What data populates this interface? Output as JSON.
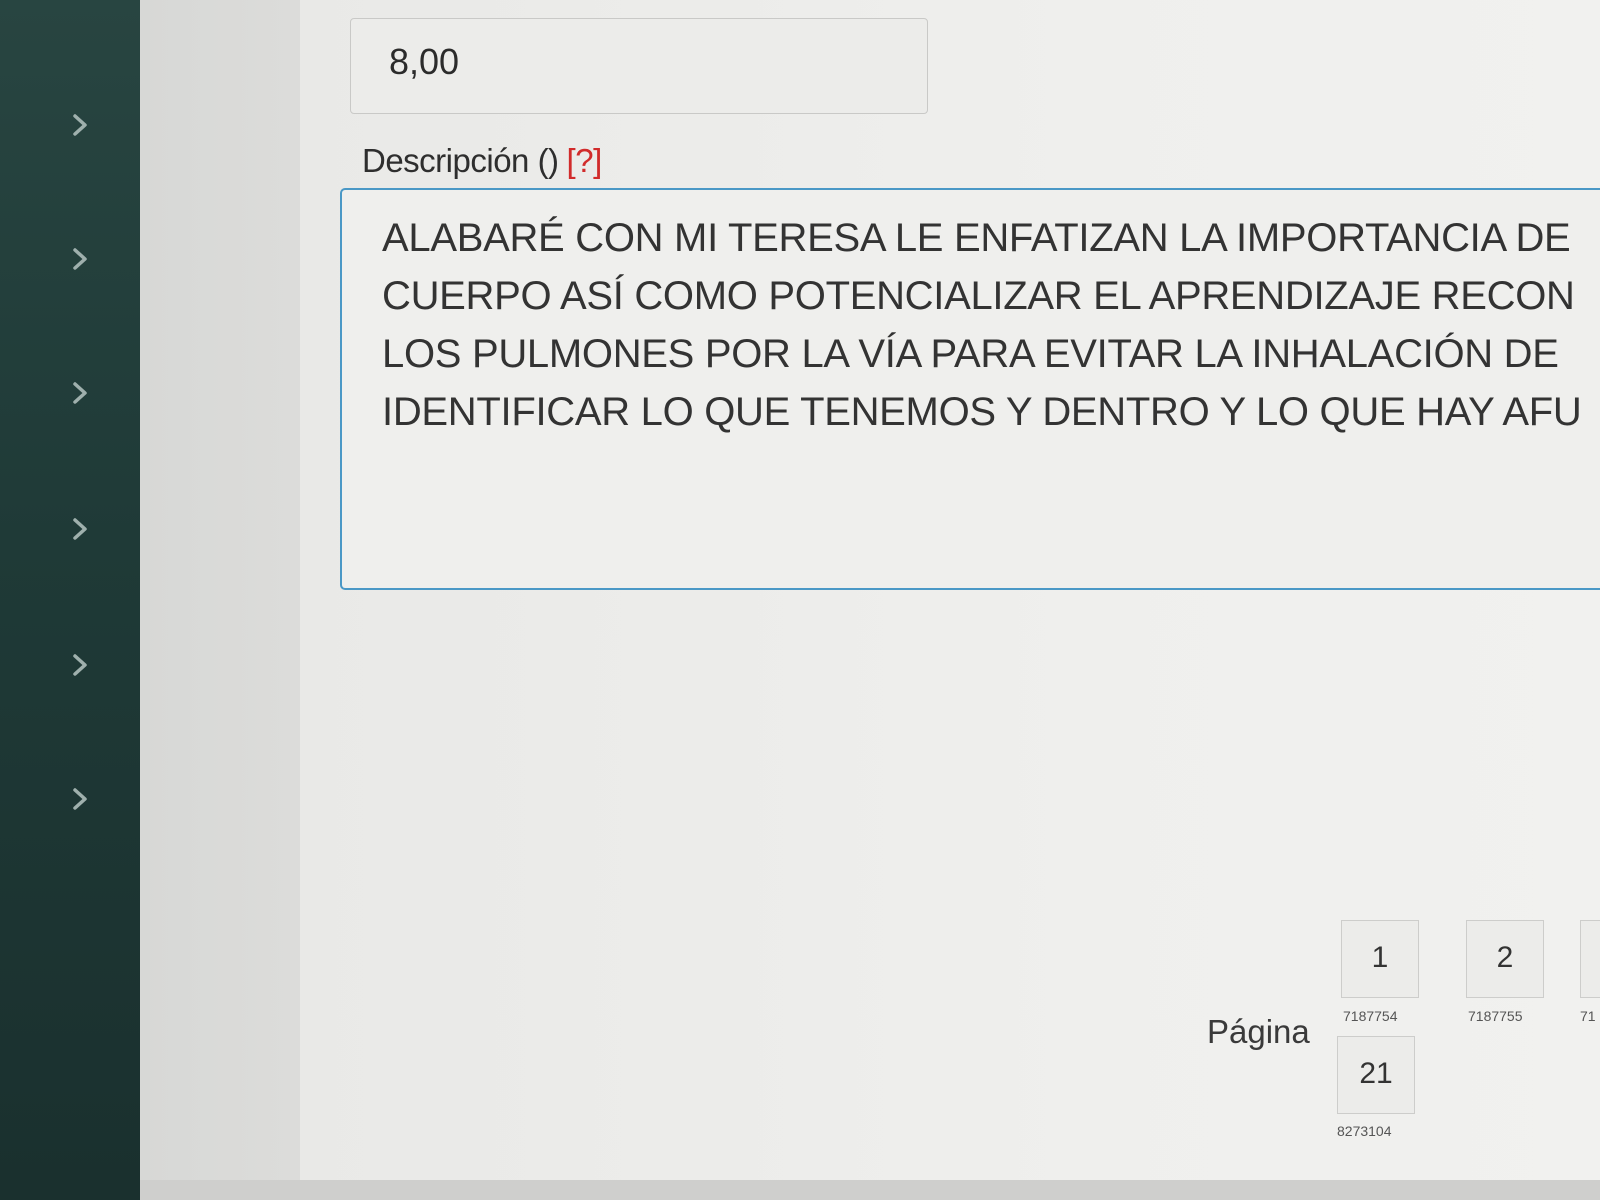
{
  "sidebar": {
    "items": [
      {
        "icon": "chevron-right-icon"
      },
      {
        "icon": "chevron-right-icon"
      },
      {
        "icon": "chevron-right-icon"
      },
      {
        "icon": "chevron-right-icon"
      },
      {
        "icon": "chevron-right-icon"
      },
      {
        "icon": "chevron-right-icon"
      }
    ]
  },
  "form": {
    "value_field": {
      "value": "8,00"
    },
    "description": {
      "label": "Descripción ()",
      "help": "[?]",
      "lines": [
        "ALABARÉ CON MI TERESA LE ENFATIZAN LA IMPORTANCIA DE",
        "CUERPO ASÍ COMO POTENCIALIZAR EL APRENDIZAJE RECON",
        "LOS PULMONES POR LA VÍA PARA EVITAR LA INHALACIÓN DE",
        "IDENTIFICAR LO QUE TENEMOS Y DENTRO Y LO QUE HAY AFU"
      ]
    }
  },
  "pagination": {
    "label": "Página",
    "pages": [
      {
        "number": "1",
        "id": "7187754"
      },
      {
        "number": "2",
        "id": "7187755"
      },
      {
        "number": "",
        "id": "71"
      },
      {
        "number": "21",
        "id": "8273104"
      }
    ]
  },
  "colors": {
    "sidebar": "#1f3a37",
    "focus_border": "#4a98c6",
    "help_link": "#d12b2b"
  }
}
